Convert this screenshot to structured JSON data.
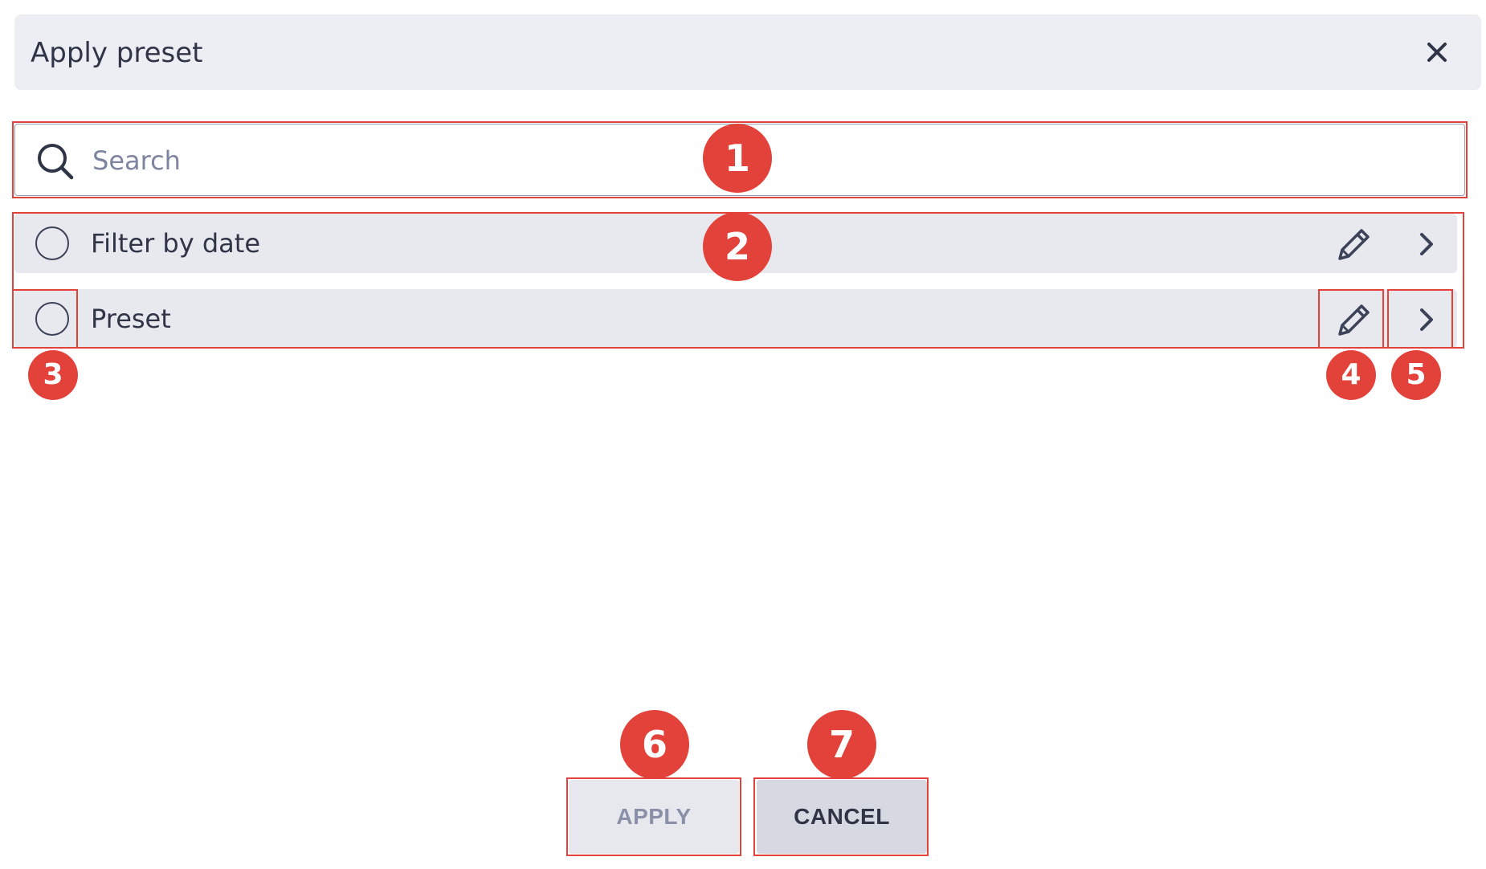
{
  "dialog": {
    "title": "Apply preset",
    "close_icon": "close-icon"
  },
  "search": {
    "icon": "search-icon",
    "placeholder": "Search",
    "value": ""
  },
  "presets": [
    {
      "label": "Filter by date",
      "selected": false,
      "edit_icon": "pencil-icon",
      "open_icon": "chevron-right-icon"
    },
    {
      "label": "Preset",
      "selected": false,
      "edit_icon": "pencil-icon",
      "open_icon": "chevron-right-icon"
    }
  ],
  "footer": {
    "apply_label": "APPLY",
    "cancel_label": "CANCEL"
  },
  "annotations": [
    "1",
    "2",
    "3",
    "4",
    "5",
    "6",
    "7"
  ],
  "colors": {
    "accent": "#e3423a",
    "header_bg": "#eceef3",
    "row_bg": "#e8e9ef",
    "text": "#2f3447",
    "muted_text": "#8a90a7"
  }
}
